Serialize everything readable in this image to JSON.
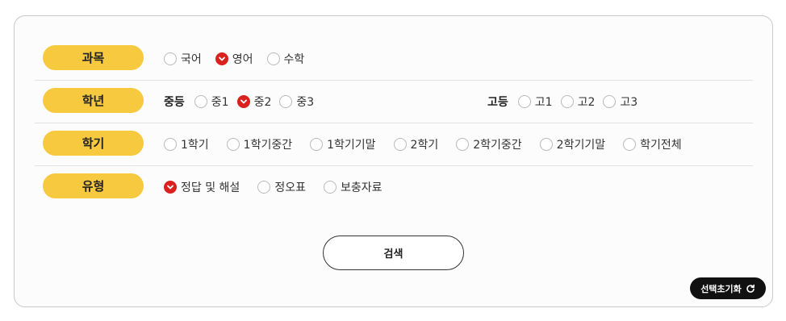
{
  "filters": {
    "subject": {
      "label": "과목",
      "options": [
        {
          "label": "국어",
          "checked": false
        },
        {
          "label": "영어",
          "checked": true
        },
        {
          "label": "수학",
          "checked": false
        }
      ]
    },
    "grade": {
      "label": "학년",
      "middle": {
        "label": "중등",
        "options": [
          {
            "label": "중1",
            "checked": false
          },
          {
            "label": "중2",
            "checked": true
          },
          {
            "label": "중3",
            "checked": false
          }
        ]
      },
      "high": {
        "label": "고등",
        "options": [
          {
            "label": "고1",
            "checked": false
          },
          {
            "label": "고2",
            "checked": false
          },
          {
            "label": "고3",
            "checked": false
          }
        ]
      }
    },
    "semester": {
      "label": "학기",
      "options": [
        {
          "label": "1학기",
          "checked": false
        },
        {
          "label": "1학기중간",
          "checked": false
        },
        {
          "label": "1학기기말",
          "checked": false
        },
        {
          "label": "2학기",
          "checked": false
        },
        {
          "label": "2학기중간",
          "checked": false
        },
        {
          "label": "2학기기말",
          "checked": false
        },
        {
          "label": "학기전체",
          "checked": false
        }
      ]
    },
    "type": {
      "label": "유형",
      "options": [
        {
          "label": "정답 및 해설",
          "checked": true
        },
        {
          "label": "정오표",
          "checked": false
        },
        {
          "label": "보충자료",
          "checked": false
        }
      ]
    }
  },
  "actions": {
    "search_label": "검색",
    "reset_label": "선택초기화",
    "reset_icon": "refresh-icon"
  },
  "colors": {
    "pill": "#f7c93e",
    "checked": "#d9211f",
    "reset_bg": "#111111"
  }
}
